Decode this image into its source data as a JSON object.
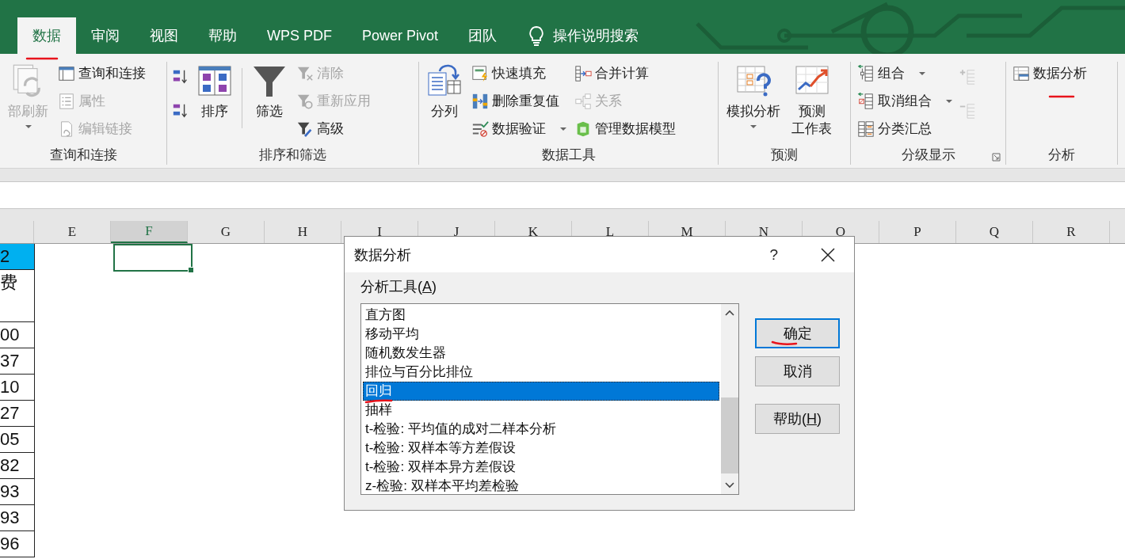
{
  "tabs": [
    {
      "label": "数据",
      "selected": true
    },
    {
      "label": "审阅",
      "selected": false
    },
    {
      "label": "视图",
      "selected": false
    },
    {
      "label": "帮助",
      "selected": false
    },
    {
      "label": "WPS PDF",
      "selected": false
    },
    {
      "label": "Power Pivot",
      "selected": false
    },
    {
      "label": "团队",
      "selected": false
    }
  ],
  "tell_me": {
    "label": "操作说明搜索"
  },
  "ribbon": {
    "groups": [
      {
        "label": "查询和连接",
        "columns": [
          [
            {
              "kind": "large",
              "label": "部刷新",
              "disabled": true,
              "dropdown": true
            }
          ],
          [
            {
              "kind": "small",
              "label": "查询和连接",
              "disabled": false,
              "dropdown": false
            },
            {
              "kind": "small",
              "label": "属性",
              "disabled": true,
              "dropdown": false
            },
            {
              "kind": "small",
              "label": "编辑链接",
              "disabled": true,
              "dropdown": false
            }
          ]
        ]
      },
      {
        "label": "排序和筛选",
        "columns": [
          [
            {
              "kind": "icon",
              "disabled": false
            },
            {
              "kind": "icon",
              "disabled": false
            }
          ],
          [
            {
              "kind": "large",
              "label": "排序",
              "disabled": false,
              "dropdown": false
            }
          ],
          [
            {
              "kind": "separator"
            }
          ],
          [
            {
              "kind": "large",
              "label": "筛选",
              "disabled": false,
              "dropdown": false
            }
          ],
          [
            {
              "kind": "small",
              "label": "清除",
              "disabled": true,
              "dropdown": false
            },
            {
              "kind": "small",
              "label": "重新应用",
              "disabled": true,
              "dropdown": false
            },
            {
              "kind": "small",
              "label": "高级",
              "disabled": false,
              "dropdown": false
            }
          ]
        ]
      },
      {
        "label": "数据工具",
        "columns": [
          [
            {
              "kind": "large",
              "label": "分列",
              "disabled": false,
              "dropdown": false
            }
          ],
          [
            {
              "kind": "small",
              "label": "快速填充",
              "disabled": false,
              "dropdown": false
            },
            {
              "kind": "small",
              "label": "删除重复值",
              "disabled": false,
              "dropdown": false
            },
            {
              "kind": "small",
              "label": "数据验证",
              "disabled": false,
              "dropdown": true
            }
          ],
          [
            {
              "kind": "small",
              "label": "合并计算",
              "disabled": false,
              "dropdown": false
            },
            {
              "kind": "small",
              "label": "关系",
              "disabled": true,
              "dropdown": false
            },
            {
              "kind": "small",
              "label": "管理数据模型",
              "disabled": false,
              "dropdown": false
            }
          ]
        ]
      },
      {
        "label": "预测",
        "columns": [
          [
            {
              "kind": "large",
              "label": "模拟分析",
              "disabled": false,
              "dropdown": true
            }
          ],
          [
            {
              "kind": "large",
              "lines": [
                "预测",
                "工作表"
              ],
              "disabled": false,
              "dropdown": false
            }
          ]
        ]
      },
      {
        "label": "分级显示",
        "launcher": true,
        "columns": [
          [
            {
              "kind": "small",
              "label": "组合",
              "disabled": false,
              "dropdown": true
            },
            {
              "kind": "small",
              "label": "取消组合",
              "disabled": false,
              "dropdown": true
            },
            {
              "kind": "small",
              "label": "分类汇总",
              "disabled": false,
              "dropdown": false
            }
          ],
          [
            {
              "kind": "icon",
              "disabled": true
            },
            {
              "kind": "icon",
              "disabled": true
            }
          ]
        ]
      },
      {
        "label": "分析",
        "columns": [
          [
            {
              "kind": "small",
              "label": "数据分析",
              "disabled": false,
              "dropdown": false
            }
          ]
        ]
      }
    ]
  },
  "sheet": {
    "columns": [
      {
        "label": "E",
        "selected": false
      },
      {
        "label": "F",
        "selected": true
      },
      {
        "label": "G",
        "selected": false
      },
      {
        "label": "H",
        "selected": false
      },
      {
        "label": "I",
        "selected": false
      },
      {
        "label": "J",
        "selected": false
      },
      {
        "label": "K",
        "selected": false
      },
      {
        "label": "L",
        "selected": false
      },
      {
        "label": "M",
        "selected": false
      },
      {
        "label": "N",
        "selected": false
      },
      {
        "label": "O",
        "selected": false
      },
      {
        "label": "P",
        "selected": false
      },
      {
        "label": "Q",
        "selected": false
      },
      {
        "label": "R",
        "selected": false
      }
    ],
    "column_d_cells": [
      {
        "text": "2",
        "highlighted": true,
        "tall": false
      },
      {
        "text": "费",
        "highlighted": false,
        "tall": true
      },
      {
        "text": "00",
        "highlighted": false,
        "tall": false
      },
      {
        "text": "37",
        "highlighted": false,
        "tall": false
      },
      {
        "text": "10",
        "highlighted": false,
        "tall": false
      },
      {
        "text": "27",
        "highlighted": false,
        "tall": false
      },
      {
        "text": "05",
        "highlighted": false,
        "tall": false
      },
      {
        "text": "82",
        "highlighted": false,
        "tall": false
      },
      {
        "text": "93",
        "highlighted": false,
        "tall": false
      },
      {
        "text": "93",
        "highlighted": false,
        "tall": false
      },
      {
        "text": "96",
        "highlighted": false,
        "tall": false
      }
    ]
  },
  "dialog": {
    "title": "数据分析",
    "help": "?",
    "list_label": {
      "before": "分析工具(",
      "key": "A",
      "after": ")"
    },
    "items": [
      {
        "label": "直方图",
        "selected": false
      },
      {
        "label": "移动平均",
        "selected": false
      },
      {
        "label": "随机数发生器",
        "selected": false
      },
      {
        "label": "排位与百分比排位",
        "selected": false
      },
      {
        "label": "回归",
        "selected": true
      },
      {
        "label": "抽样",
        "selected": false
      },
      {
        "label": "t-检验: 平均值的成对二样本分析",
        "selected": false
      },
      {
        "label": "t-检验: 双样本等方差假设",
        "selected": false
      },
      {
        "label": "t-检验: 双样本异方差假设",
        "selected": false
      },
      {
        "label": "z-检验: 双样本平均差检验",
        "selected": false
      }
    ],
    "buttons": [
      {
        "before": "确定",
        "default": true
      },
      {
        "before": "取消",
        "default": false
      },
      {
        "before": "帮助(",
        "key": "H",
        "after": ")",
        "default": false
      }
    ]
  }
}
